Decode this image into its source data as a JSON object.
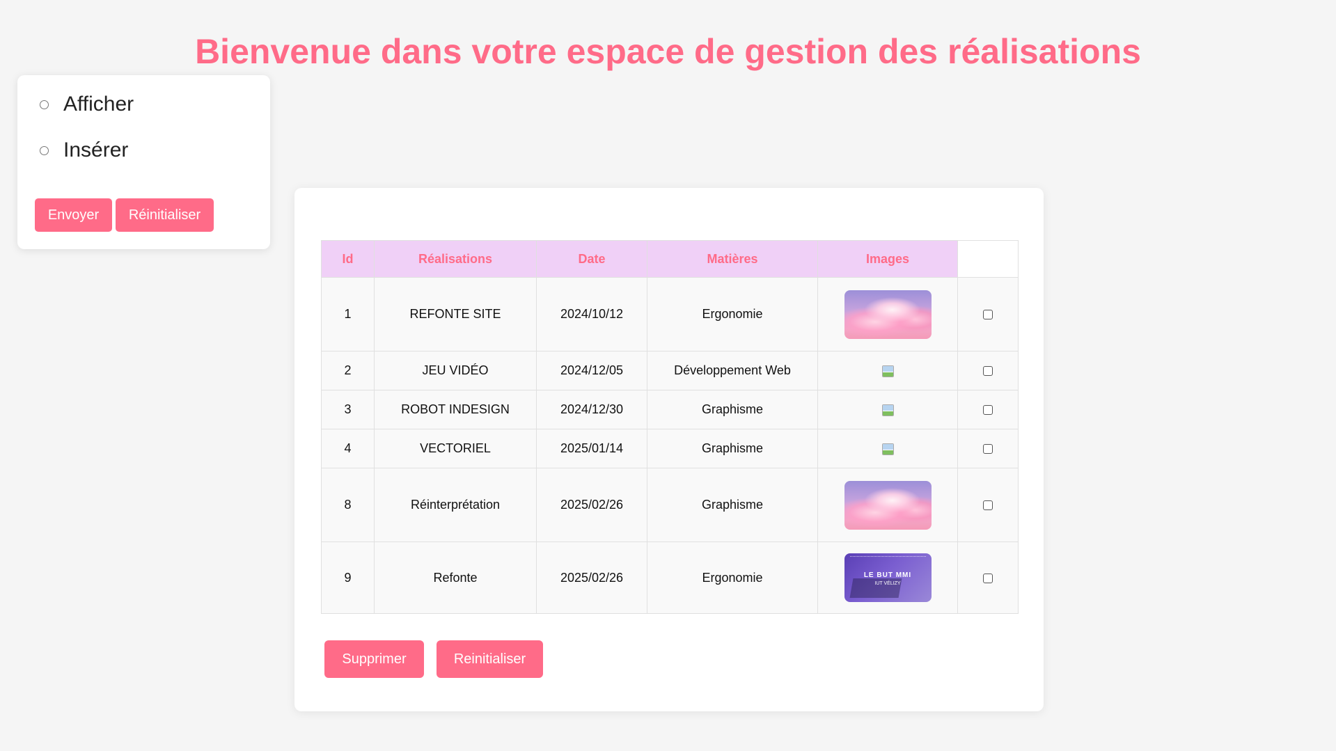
{
  "title": "Bienvenue dans votre espace de gestion des réalisations",
  "menu": {
    "options": [
      {
        "label": "Afficher"
      },
      {
        "label": "Insérer"
      }
    ],
    "send_label": "Envoyer",
    "reset_label": "Réinitialiser"
  },
  "table": {
    "headers": [
      "Id",
      "Réalisations",
      "Date",
      "Matières",
      "Images",
      ""
    ],
    "rows": [
      {
        "id": "1",
        "name": "REFONTE SITE",
        "date": "2024/10/12",
        "subject": "Ergonomie",
        "image": "clouds-thumbnail"
      },
      {
        "id": "2",
        "name": "JEU VIDÉO",
        "date": "2024/12/05",
        "subject": "Développement Web",
        "image": "broken-image-icon"
      },
      {
        "id": "3",
        "name": "ROBOT INDESIGN",
        "date": "2024/12/30",
        "subject": "Graphisme",
        "image": "broken-image-icon"
      },
      {
        "id": "4",
        "name": "VECTORIEL",
        "date": "2025/01/14",
        "subject": "Graphisme",
        "image": "broken-image-icon"
      },
      {
        "id": "8",
        "name": "Réinterprétation",
        "date": "2025/02/26",
        "subject": "Graphisme",
        "image": "clouds-thumbnail"
      },
      {
        "id": "9",
        "name": "Refonte",
        "date": "2025/02/26",
        "subject": "Ergonomie",
        "image": "website-thumbnail"
      }
    ],
    "thumb_text": {
      "line1": "LE BUT MMI",
      "line2": "IUT VÉLIZY"
    }
  },
  "actions": {
    "delete_label": "Supprimer",
    "reset_label": "Reinitialiser"
  },
  "colors": {
    "accent": "#ff6b88",
    "header_bg": "#f0d0f7",
    "page_bg": "#f5f5f5"
  }
}
